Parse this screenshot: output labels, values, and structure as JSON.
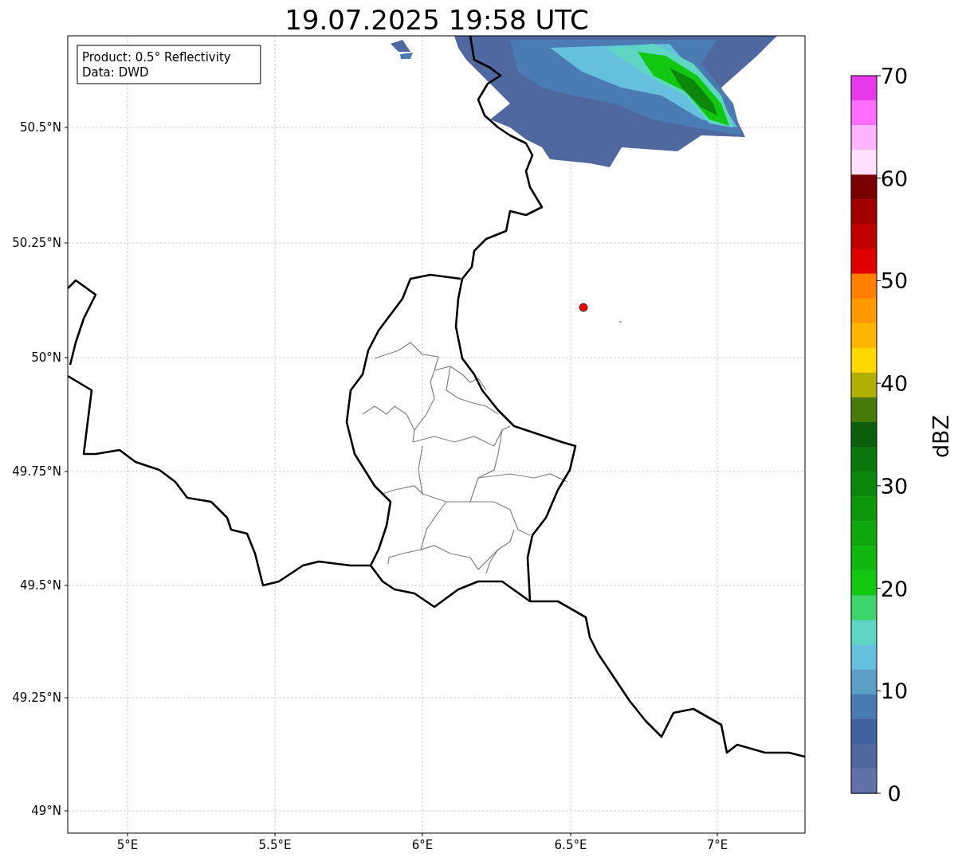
{
  "title": "19.07.2025 19:58 UTC",
  "legend": [
    "Product: 0.5° Reflectivity",
    "Data: DWD"
  ],
  "latitude_labels": [
    "50.5°N",
    "50.25°N",
    "50°N",
    "49.75°N",
    "49.5°N",
    "49.25°N",
    "49°N"
  ],
  "longitude_labels": [
    "5°E",
    "5.5°E",
    "6°E",
    "6.5°E",
    "7°E"
  ],
  "colorbar": {
    "label": "dBZ",
    "ticks": [
      "70",
      "60",
      "50",
      "40",
      "30",
      "20",
      "10",
      "0"
    ],
    "bins": [
      {
        "color": "#e83ae8"
      },
      {
        "color": "#ff6eff"
      },
      {
        "color": "#ffb4ff"
      },
      {
        "color": "#ffe0ff"
      },
      {
        "color": "#7a0000"
      },
      {
        "color": "#a00000"
      },
      {
        "color": "#c00000"
      },
      {
        "color": "#e00000"
      },
      {
        "color": "#ff7f00"
      },
      {
        "color": "#ff9900"
      },
      {
        "color": "#ffb400"
      },
      {
        "color": "#ffd700"
      },
      {
        "color": "#b0b000"
      },
      {
        "color": "#467a0a"
      },
      {
        "color": "#0b5e0b"
      },
      {
        "color": "#0b760b"
      },
      {
        "color": "#0c870c"
      },
      {
        "color": "#0d970d"
      },
      {
        "color": "#0ea80e"
      },
      {
        "color": "#10b810"
      },
      {
        "color": "#10c810"
      },
      {
        "color": "#3dd56b"
      },
      {
        "color": "#5fd6c4"
      },
      {
        "color": "#65c0de"
      },
      {
        "color": "#5b9ec6"
      },
      {
        "color": "#4a7bb3"
      },
      {
        "color": "#4060a0"
      },
      {
        "color": "#5068a0"
      },
      {
        "color": "#6272a8"
      }
    ]
  }
}
